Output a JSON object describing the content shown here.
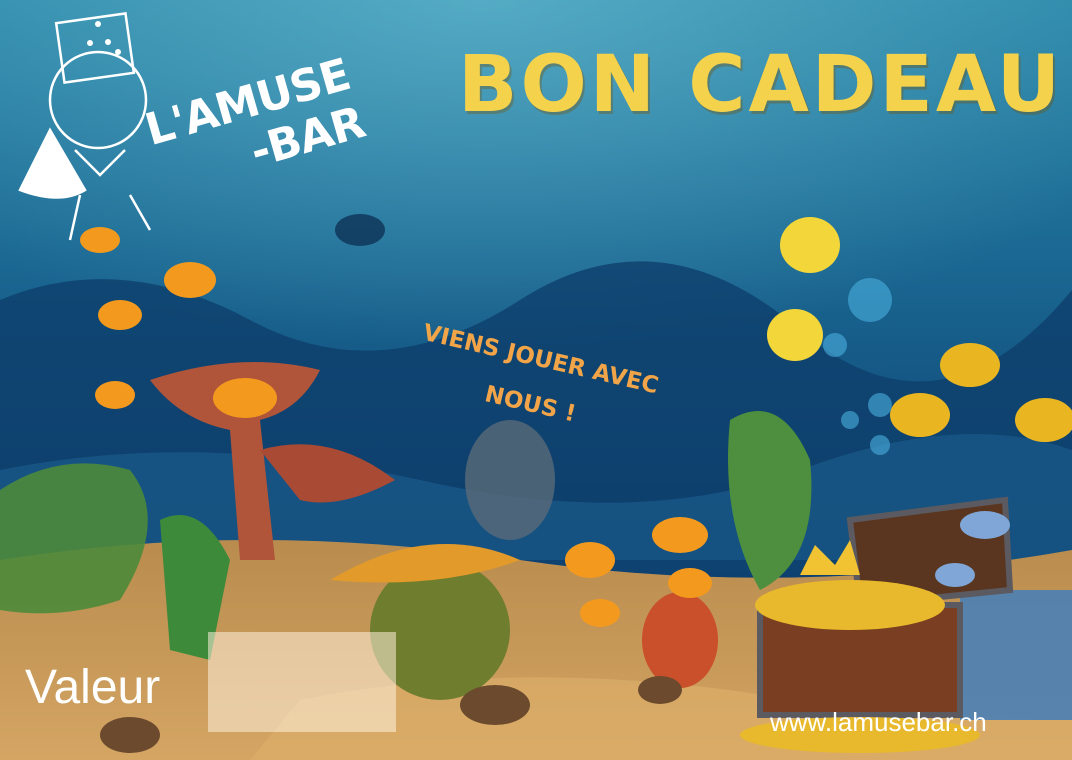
{
  "voucher": {
    "title": "BON CADEAU",
    "slogan_line1": "VIENS JOUER AVEC",
    "slogan_line2": "NOUS !",
    "brand_line1": "L'AMUSE",
    "brand_line2": "-BAR",
    "value_label": "Valeur",
    "value_amount": "",
    "website": "www.lamusebar.ch"
  },
  "colors": {
    "title": "#f5d24b",
    "slogan": "#f2a548",
    "water_top": "#2a7fa3",
    "water_deep": "#0d3a66",
    "sand": "#c99a55"
  }
}
